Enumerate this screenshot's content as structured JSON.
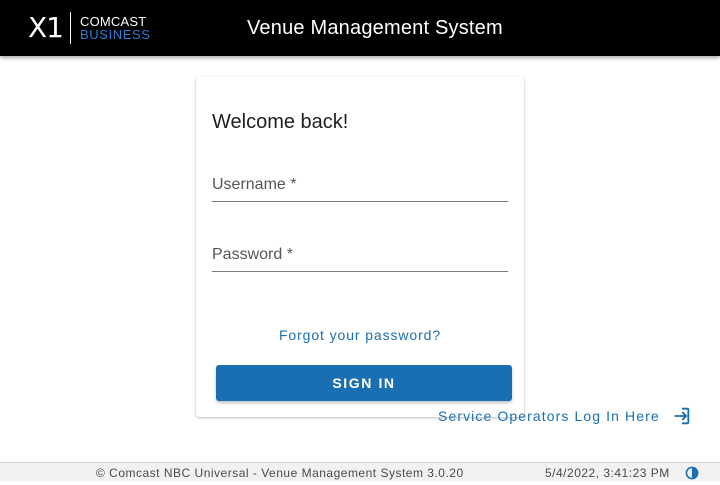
{
  "header": {
    "logo_x1": "X1",
    "logo_brand": "COMCAST",
    "logo_sub": "BUSINESS",
    "title": "Venue Management System"
  },
  "login": {
    "heading": "Welcome back!",
    "username_label": "Username *",
    "password_label": "Password *",
    "forgot_link": "Forgot your password?",
    "signin_label": "SIGN IN"
  },
  "service_link": {
    "label": "Service Operators Log In Here",
    "icon": "login-icon"
  },
  "footer": {
    "copyright": "© Comcast NBC Universal - Venue Management System 3.0.20",
    "datetime": "5/4/2022, 3:41:23 PM",
    "icon": "contrast-icon"
  },
  "colors": {
    "header_bg": "#000000",
    "accent": "#1a6fb3",
    "brand_blue": "#2a7bd6",
    "footer_bg": "#f1f1f1"
  }
}
